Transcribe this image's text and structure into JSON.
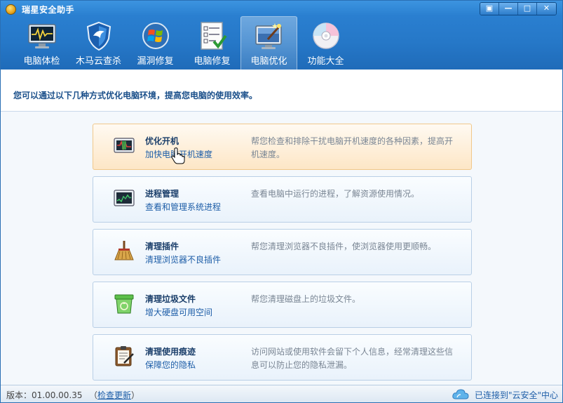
{
  "window": {
    "title": "瑞星安全助手"
  },
  "window_controls": [
    "▣",
    "—",
    "□",
    "✕"
  ],
  "toolbar": [
    {
      "label": "电脑体检",
      "icon": "monitor-pulse-icon"
    },
    {
      "label": "木马云查杀",
      "icon": "shield-icon"
    },
    {
      "label": "漏洞修复",
      "icon": "windows-logo-icon"
    },
    {
      "label": "电脑修复",
      "icon": "checklist-icon"
    },
    {
      "label": "电脑优化",
      "icon": "monitor-wand-icon",
      "active": true
    },
    {
      "label": "功能大全",
      "icon": "disc-icon"
    }
  ],
  "info": {
    "text": "您可以通过以下几种方式优化电脑环境，提高您电脑的使用效率。"
  },
  "items": [
    {
      "title": "优化开机",
      "subtitle": "加快电脑开机速度",
      "description": "帮您检查和排除干扰电脑开机速度的各种因素，提高开机速度。",
      "icon": "boot-optimize-icon",
      "hover": true
    },
    {
      "title": "进程管理",
      "subtitle": "查看和管理系统进程",
      "description": "查看电脑中运行的进程，了解资源使用情况。",
      "icon": "process-monitor-icon"
    },
    {
      "title": "清理插件",
      "subtitle": "清理浏览器不良插件",
      "description": "帮您清理浏览器不良插件，使浏览器使用更顺畅。",
      "icon": "broom-icon"
    },
    {
      "title": "清理垃圾文件",
      "subtitle": "增大硬盘可用空间",
      "description": "帮您清理磁盘上的垃圾文件。",
      "icon": "recycle-bin-icon"
    },
    {
      "title": "清理使用痕迹",
      "subtitle": "保障您的隐私",
      "description": "访问网站或使用软件会留下个人信息，经常清理这些信息可以防止您的隐私泄漏。",
      "icon": "clipboard-pen-icon"
    }
  ],
  "status": {
    "version": "版本：01.00.00.35",
    "update_open": "（",
    "update_link": "检查更新",
    "update_close": "）",
    "connection": "已连接到\"云安全\"中心"
  },
  "colors": {
    "title_bar": "#2a7fd0",
    "accent_text": "#1e5ea8",
    "hover_bg": "#fde6c6"
  }
}
